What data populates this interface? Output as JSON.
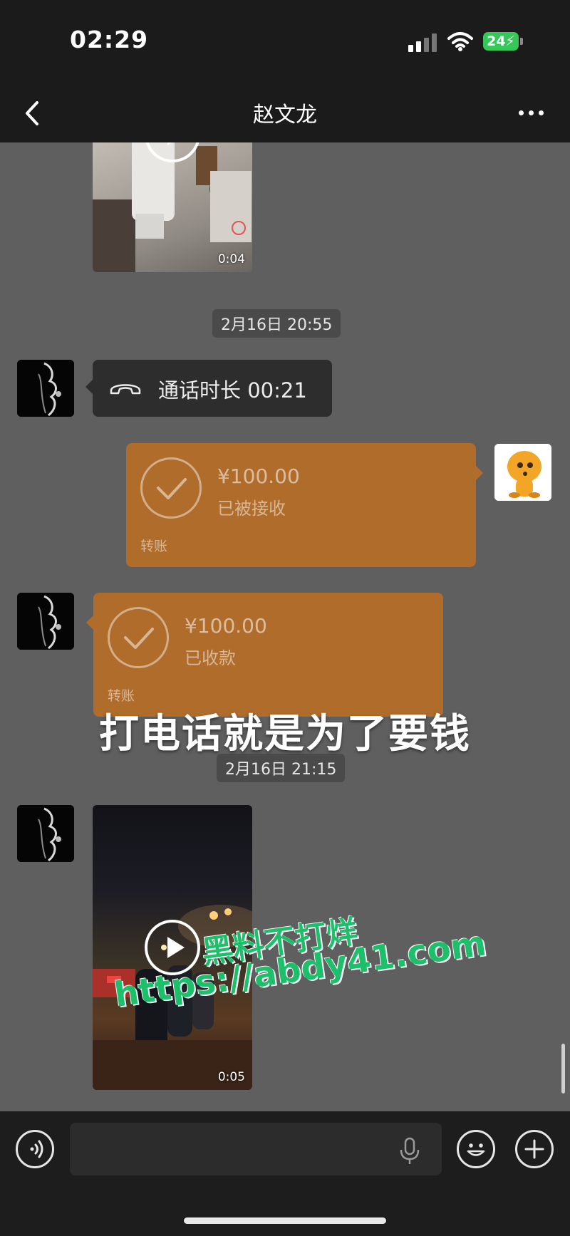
{
  "status_bar": {
    "time": "02:29",
    "battery": "24"
  },
  "nav": {
    "title": "赵文龙"
  },
  "messages": {
    "video1": {
      "duration": "0:04"
    },
    "timestamp1": "2月16日 20:55",
    "call": {
      "text": "通话时长 00:21"
    },
    "transfer_sent": {
      "amount": "¥100.00",
      "status": "已被接收",
      "label": "转账"
    },
    "transfer_received": {
      "amount": "¥100.00",
      "status": "已收款",
      "label": "转账"
    },
    "timestamp2": "2月16日 21:15",
    "video2": {
      "duration": "0:05"
    }
  },
  "overlay": {
    "caption": "打电话就是为了要钱",
    "watermark_line1": "黑料不打烊",
    "watermark_line2": "https://abdy41.com"
  },
  "colors": {
    "transfer_orange": "#b06c2a",
    "watermark_green": "#1dbf6b",
    "battery_green": "#35c759"
  },
  "icons": [
    "signal-icon",
    "wifi-icon",
    "back-chevron-icon",
    "more-icon",
    "phone-hangup-icon",
    "check-circle-icon",
    "play-icon",
    "voice-icon",
    "mic-icon",
    "emoji-icon",
    "plus-icon"
  ]
}
